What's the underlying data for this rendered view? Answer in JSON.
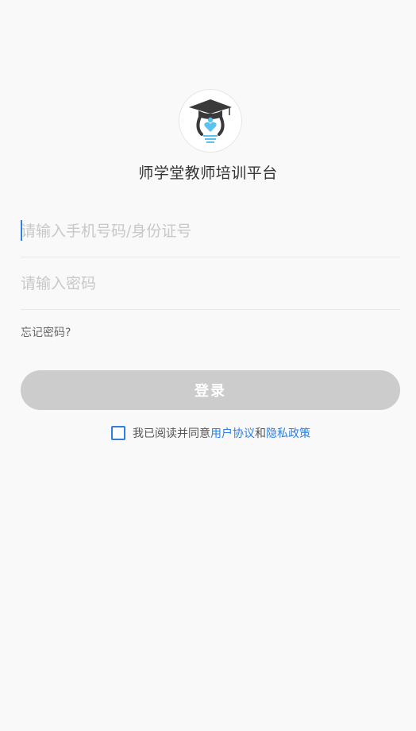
{
  "header": {
    "app_title": "师学堂教师培训平台"
  },
  "form": {
    "phone_placeholder": "请输入手机号码/身份证号",
    "password_placeholder": "请输入密码",
    "forgot_password": "忘记密码?",
    "login_label": "登录"
  },
  "agreement": {
    "prefix": "我已阅读并同意",
    "user_agreement": "用户协议",
    "and": "和",
    "privacy_policy": "隐私政策",
    "checked": false
  },
  "colors": {
    "accent": "#2f7fe0",
    "button_disabled": "#cccccc",
    "background": "#f9f9f9",
    "logo_dark": "#3a3a3a",
    "logo_light_blue": "#5bc2f0"
  },
  "icons": {
    "logo": "graduation-cap-heart-logo"
  }
}
